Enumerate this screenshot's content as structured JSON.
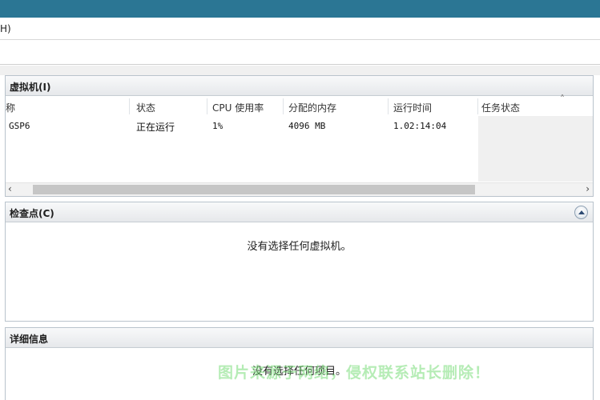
{
  "menubar": {
    "help_label": "H)"
  },
  "vm_panel": {
    "title": "虚拟机(I)",
    "columns": [
      "称",
      "状态",
      "CPU 使用率",
      "分配的内存",
      "运行时间",
      "任务状态"
    ],
    "rows": [
      {
        "name": "GSP6",
        "state": "正在运行",
        "cpu": "1%",
        "memory": "4096 MB",
        "uptime": "1.02:14:04",
        "task": ""
      }
    ]
  },
  "checkpoint_panel": {
    "title": "检查点(C)",
    "message": "没有选择任何虚拟机。"
  },
  "detail_panel": {
    "title": "详细信息",
    "message": "没有选择任何项目。"
  },
  "watermark": "图片来源于网络，侵权联系站长删除！",
  "colors": {
    "titlebar": "#2b7694",
    "panel_border": "#b9c3cc",
    "watermark": "#78dc78"
  }
}
